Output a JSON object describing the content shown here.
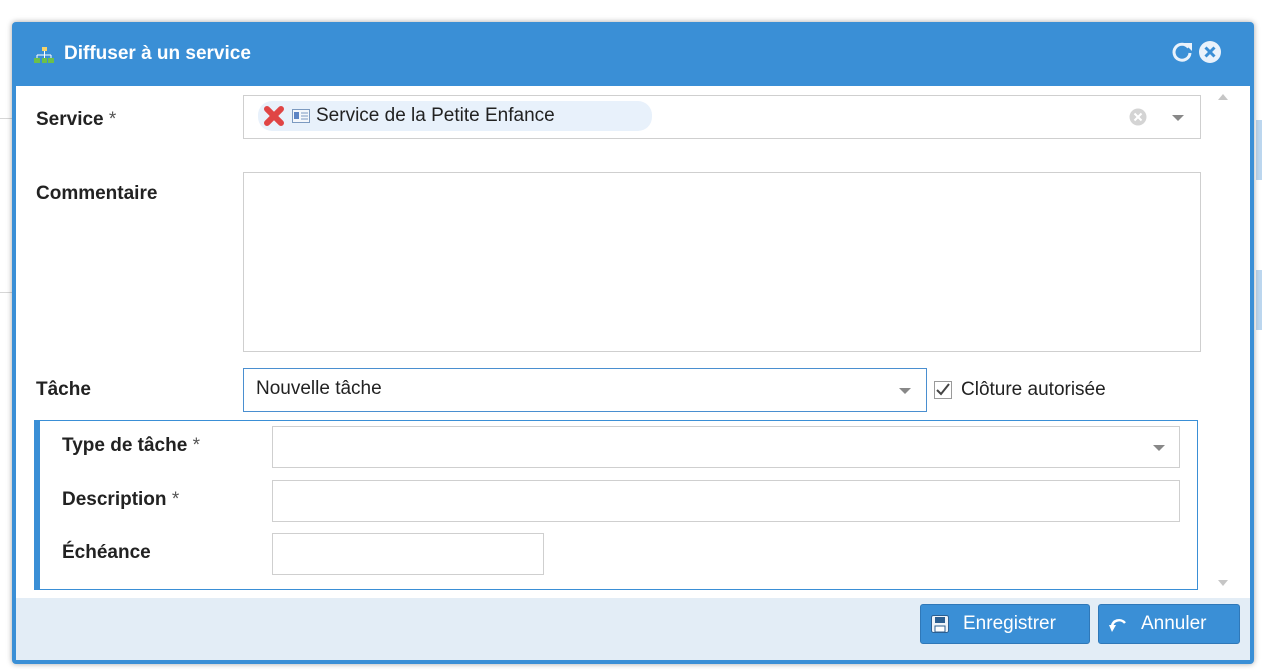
{
  "dialog": {
    "title": "Diffuser à un service"
  },
  "service": {
    "label": "Service",
    "required": "*",
    "selected": "Service de la Petite Enfance"
  },
  "commentaire": {
    "label": "Commentaire",
    "value": ""
  },
  "tache": {
    "label": "Tâche",
    "value": "Nouvelle tâche",
    "cloture_label": "Clôture autorisée",
    "cloture_checked": true
  },
  "type_tache": {
    "label": "Type de tâche",
    "required": "*",
    "value": ""
  },
  "description": {
    "label": "Description",
    "required": "*",
    "value": ""
  },
  "echeance": {
    "label": "Échéance",
    "value": ""
  },
  "buttons": {
    "save": "Enregistrer",
    "cancel": "Annuler"
  },
  "colors": {
    "accent": "#3a8fd6",
    "footer": "#e3edf6",
    "chip": "#e8f1fb",
    "remove": "#e04545"
  }
}
